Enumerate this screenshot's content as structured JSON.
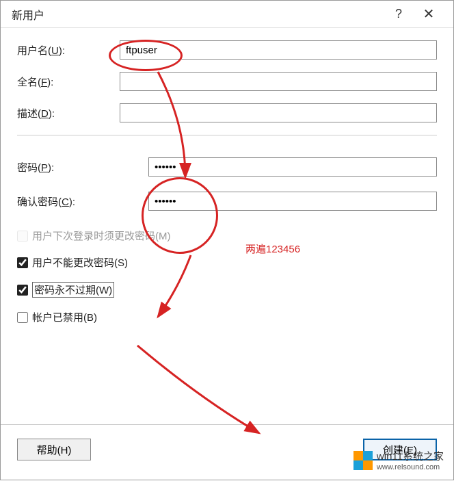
{
  "titlebar": {
    "title": "新用户"
  },
  "labels": {
    "username": "用户名(",
    "username_u": "U",
    "username_end": "):",
    "fullname": "全名(",
    "fullname_u": "F",
    "fullname_end": "):",
    "description": "描述(",
    "description_u": "D",
    "description_end": "):",
    "password": "密码(",
    "password_u": "P",
    "password_end": "):",
    "confirm": "确认密码(",
    "confirm_u": "C",
    "confirm_end": "):"
  },
  "values": {
    "username": "ftpuser",
    "fullname": "",
    "description": "",
    "password": "••••••",
    "confirm": "••••••"
  },
  "checkboxes": {
    "must_change": {
      "label": "用户下次登录时须更改密码(M)",
      "checked": false,
      "disabled": true
    },
    "cannot_change": {
      "label": "用户不能更改密码(S)",
      "checked": true
    },
    "never_expire": {
      "label": "密码永不过期(W)",
      "checked": true
    },
    "disabled_acct": {
      "label": "帐户已禁用(B)",
      "checked": false
    }
  },
  "buttons": {
    "help": "帮助(H)",
    "create": "创建(E)"
  },
  "annotations": {
    "redtext": "两遍123456"
  },
  "watermark": {
    "line1": "win11系统之家",
    "line2": "www.relsound.com"
  }
}
